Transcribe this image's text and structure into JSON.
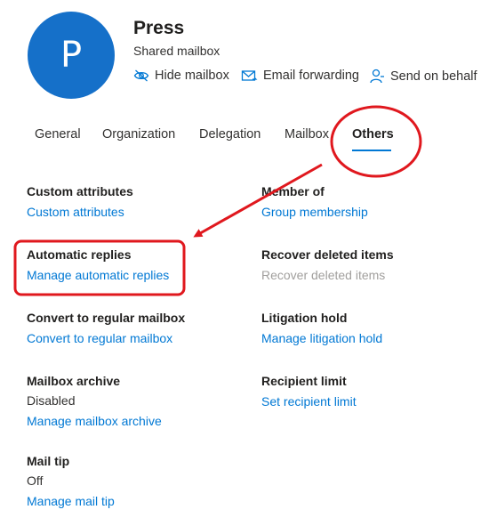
{
  "header": {
    "avatar_letter": "P",
    "title": "Press",
    "subtitle": "Shared mailbox",
    "actions": [
      {
        "label": "Hide mailbox",
        "icon": "eye-slash-icon"
      },
      {
        "label": "Email forwarding",
        "icon": "mail-forward-icon"
      },
      {
        "label": "Send on behalf",
        "icon": "person-icon"
      }
    ]
  },
  "tabs": [
    {
      "label": "General"
    },
    {
      "label": "Organization"
    },
    {
      "label": "Delegation"
    },
    {
      "label": "Mailbox"
    },
    {
      "label": "Others",
      "active": true
    }
  ],
  "sections": {
    "custom_attributes": {
      "title": "Custom attributes",
      "link": "Custom attributes"
    },
    "member_of": {
      "title": "Member of",
      "link": "Group membership"
    },
    "automatic_replies": {
      "title": "Automatic replies",
      "link": "Manage automatic replies"
    },
    "recover_deleted": {
      "title": "Recover deleted items",
      "link": "Recover deleted items",
      "disabled": true
    },
    "convert": {
      "title": "Convert to regular mailbox",
      "link": "Convert to regular mailbox"
    },
    "litigation_hold": {
      "title": "Litigation hold",
      "link": "Manage litigation hold"
    },
    "mailbox_archive": {
      "title": "Mailbox archive",
      "value": "Disabled",
      "link": "Manage mailbox archive"
    },
    "recipient_limit": {
      "title": "Recipient limit",
      "link": "Set recipient limit"
    },
    "mail_tip": {
      "title": "Mail tip",
      "value": "Off",
      "link": "Manage mail tip"
    }
  },
  "colors": {
    "accent": "#0078d4",
    "avatar": "#1570c9",
    "annotation": "#e0181e",
    "disabled_text": "#a19f9d"
  }
}
